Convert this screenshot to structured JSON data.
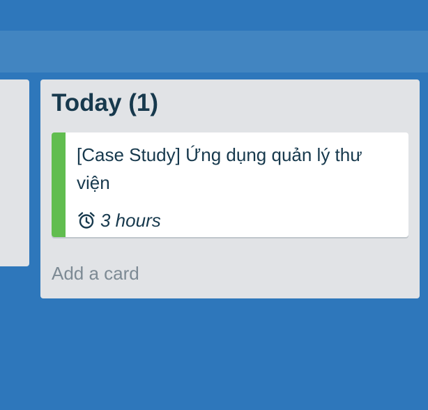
{
  "list": {
    "title": "Today (1)",
    "add_card_label": "Add a card"
  },
  "cards": [
    {
      "title": "[Case Study] Ứng dụng quản lý thư viện",
      "label_color": "#61bd4f",
      "badge": {
        "icon": "alarm-clock-icon",
        "text": "3 hours"
      }
    }
  ],
  "colors": {
    "board_background": "#2e77bb",
    "header_bar": "#4285c1",
    "list_background": "#e1e3e6",
    "text_primary": "#17394d",
    "text_muted": "#7d8a94"
  }
}
